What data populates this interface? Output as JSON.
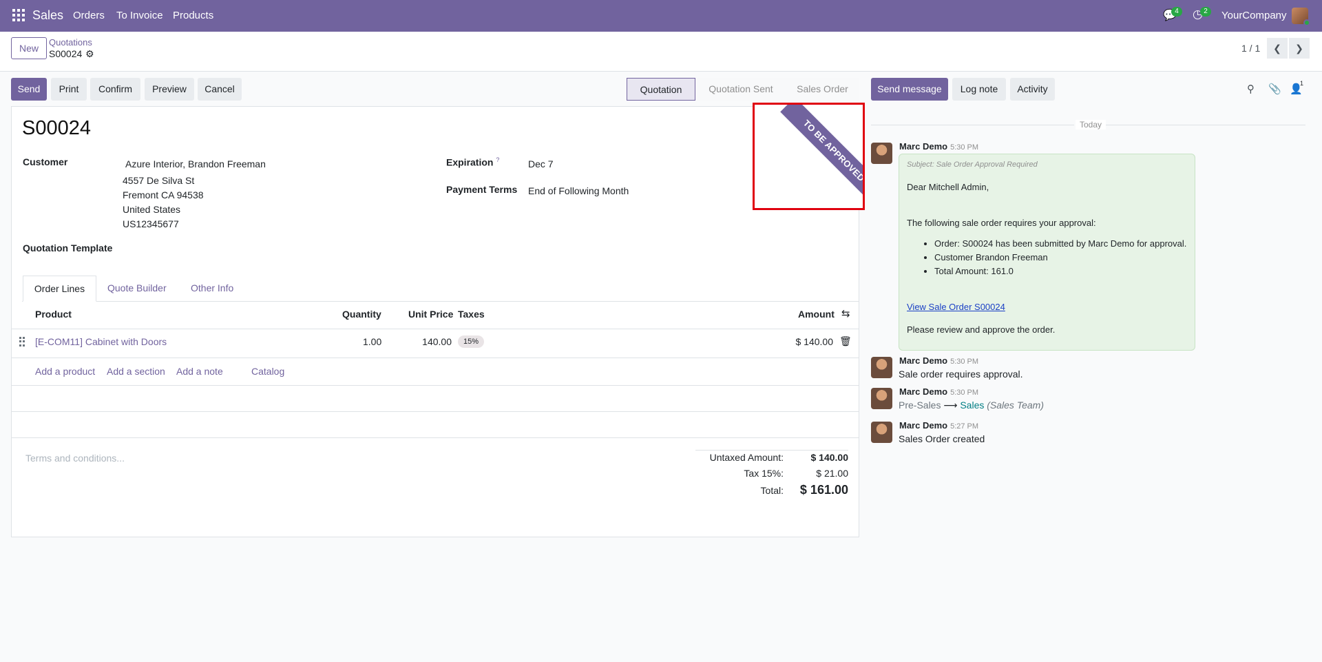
{
  "navbar": {
    "app_name": "Sales",
    "menus": [
      "Orders",
      "To Invoice",
      "Products"
    ],
    "messages_badge": "4",
    "activities_badge": "2",
    "company": "YourCompany"
  },
  "control_panel": {
    "new_label": "New",
    "breadcrumb_parent": "Quotations",
    "breadcrumb_current": "S00024",
    "pager": "1 / 1"
  },
  "actions": {
    "send": "Send",
    "print": "Print",
    "confirm": "Confirm",
    "preview": "Preview",
    "cancel": "Cancel"
  },
  "status_stages": [
    "Quotation",
    "Quotation Sent",
    "Sales Order"
  ],
  "active_stage": "Quotation",
  "form": {
    "name": "S00024",
    "customer_label": "Customer",
    "customer_name": "Azure Interior, Brandon Freeman",
    "address": [
      "4557 De Silva St",
      "Fremont CA 94538",
      "United States",
      "US12345677"
    ],
    "expiration_label": "Expiration",
    "expiration_help": "?",
    "expiration_value": "Dec 7",
    "payment_terms_label": "Payment Terms",
    "payment_terms_value": "End of Following Month",
    "template_label": "Quotation Template",
    "ribbon": "TO BE APPROVED"
  },
  "tabs": [
    "Order Lines",
    "Quote Builder",
    "Other Info"
  ],
  "table": {
    "headers": {
      "product": "Product",
      "quantity": "Quantity",
      "unit_price": "Unit Price",
      "taxes": "Taxes",
      "amount": "Amount"
    },
    "rows": [
      {
        "product": "[E-COM11] Cabinet with Doors",
        "quantity": "1.00",
        "unit_price": "140.00",
        "tax": "15%",
        "amount": "$ 140.00"
      }
    ],
    "add_product": "Add a product",
    "add_section": "Add a section",
    "add_note": "Add a note",
    "catalog": "Catalog"
  },
  "terms_placeholder": "Terms and conditions...",
  "totals": {
    "untaxed_label": "Untaxed Amount:",
    "untaxed_value": "$ 140.00",
    "tax_label": "Tax 15%:",
    "tax_value": "$ 21.00",
    "total_label": "Total:",
    "total_value": "$ 161.00"
  },
  "chatter": {
    "send_message": "Send message",
    "log_note": "Log note",
    "activity": "Activity",
    "followers_count": "1",
    "date_separator": "Today",
    "messages": [
      {
        "author": "Marc Demo",
        "time": "5:30 PM",
        "subject": "Subject: Sale Order Approval Required",
        "greeting": "Dear Mitchell Admin,",
        "intro": "The following sale order requires your approval:",
        "bullets": [
          "Order: S00024 has been submitted by Marc Demo for approval.",
          "Customer Brandon Freeman",
          "Total Amount: 161.0"
        ],
        "link": "View Sale Order S00024",
        "closing": "Please review and approve the order."
      },
      {
        "author": "Marc Demo",
        "time": "5:30 PM",
        "body": "Sale order requires approval."
      },
      {
        "author": "Marc Demo",
        "time": "5:30 PM",
        "old_value": "Pre-Sales",
        "arrow": "⟶",
        "new_value": "Sales",
        "field": "(Sales Team)"
      },
      {
        "author": "Marc Demo",
        "time": "5:27 PM",
        "body": "Sales Order created"
      }
    ]
  },
  "colors": {
    "brand": "#71639e",
    "highlight_box": "#e0000f",
    "note_bubble": "#e7f3e6"
  }
}
